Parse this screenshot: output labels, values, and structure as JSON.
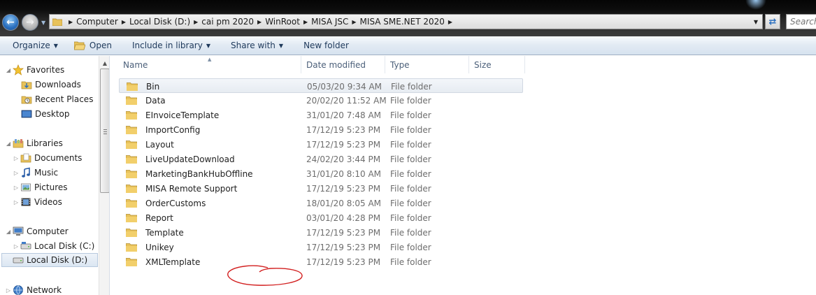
{
  "address_bar": {
    "breadcrumbs": [
      "Computer",
      "Local Disk (D:)",
      "cai pm 2020",
      "WinRoot",
      "MISA JSC",
      "MISA SME.NET 2020"
    ],
    "search_placeholder": "Search"
  },
  "toolbar": {
    "organize": "Organize",
    "open": "Open",
    "include_in_library": "Include in library",
    "share_with": "Share with",
    "new_folder": "New folder"
  },
  "nav_pane": {
    "favorites": {
      "label": "Favorites",
      "items": [
        "Downloads",
        "Recent Places",
        "Desktop"
      ]
    },
    "libraries": {
      "label": "Libraries",
      "items": [
        "Documents",
        "Music",
        "Pictures",
        "Videos"
      ]
    },
    "computer": {
      "label": "Computer",
      "items": [
        "Local Disk (C:)",
        "Local Disk (D:)"
      ],
      "selected": "Local Disk (D:)"
    },
    "network": {
      "label": "Network"
    }
  },
  "file_list": {
    "columns": {
      "name": "Name",
      "date_modified": "Date modified",
      "type": "Type",
      "size": "Size"
    },
    "rows": [
      {
        "name": "Bin",
        "date": "05/03/20 9:34 AM",
        "type": "File folder"
      },
      {
        "name": "Data",
        "date": "20/02/20 11:52 AM",
        "type": "File folder"
      },
      {
        "name": "EInvoiceTemplate",
        "date": "31/01/20 7:48 AM",
        "type": "File folder"
      },
      {
        "name": "ImportConfig",
        "date": "17/12/19 5:23 PM",
        "type": "File folder"
      },
      {
        "name": "Layout",
        "date": "17/12/19 5:23 PM",
        "type": "File folder"
      },
      {
        "name": "LiveUpdateDownload",
        "date": "24/02/20 3:44 PM",
        "type": "File folder"
      },
      {
        "name": "MarketingBankHubOffline",
        "date": "31/01/20 8:10 AM",
        "type": "File folder"
      },
      {
        "name": "MISA Remote Support",
        "date": "17/12/19 5:23 PM",
        "type": "File folder"
      },
      {
        "name": "OrderCustoms",
        "date": "18/01/20 8:05 AM",
        "type": "File folder"
      },
      {
        "name": "Report",
        "date": "03/01/20 4:28 PM",
        "type": "File folder"
      },
      {
        "name": "Template",
        "date": "17/12/19 5:23 PM",
        "type": "File folder"
      },
      {
        "name": "Unikey",
        "date": "17/12/19 5:23 PM",
        "type": "File folder"
      },
      {
        "name": "XMLTemplate",
        "date": "17/12/19 5:23 PM",
        "type": "File folder"
      }
    ],
    "hovered_row": "Bin",
    "annotated_row": "Report",
    "annotation_color": "#d21f1f"
  },
  "colors": {
    "folder": "#e8c25a",
    "command_text": "#1e395b"
  },
  "icons": {
    "back": "back-arrow-icon",
    "forward": "forward-arrow-icon",
    "refresh": "refresh-icon",
    "folder": "folder-icon",
    "favorites": "star-icon",
    "libraries": "library-icon",
    "computer": "computer-icon",
    "network": "network-icon"
  }
}
